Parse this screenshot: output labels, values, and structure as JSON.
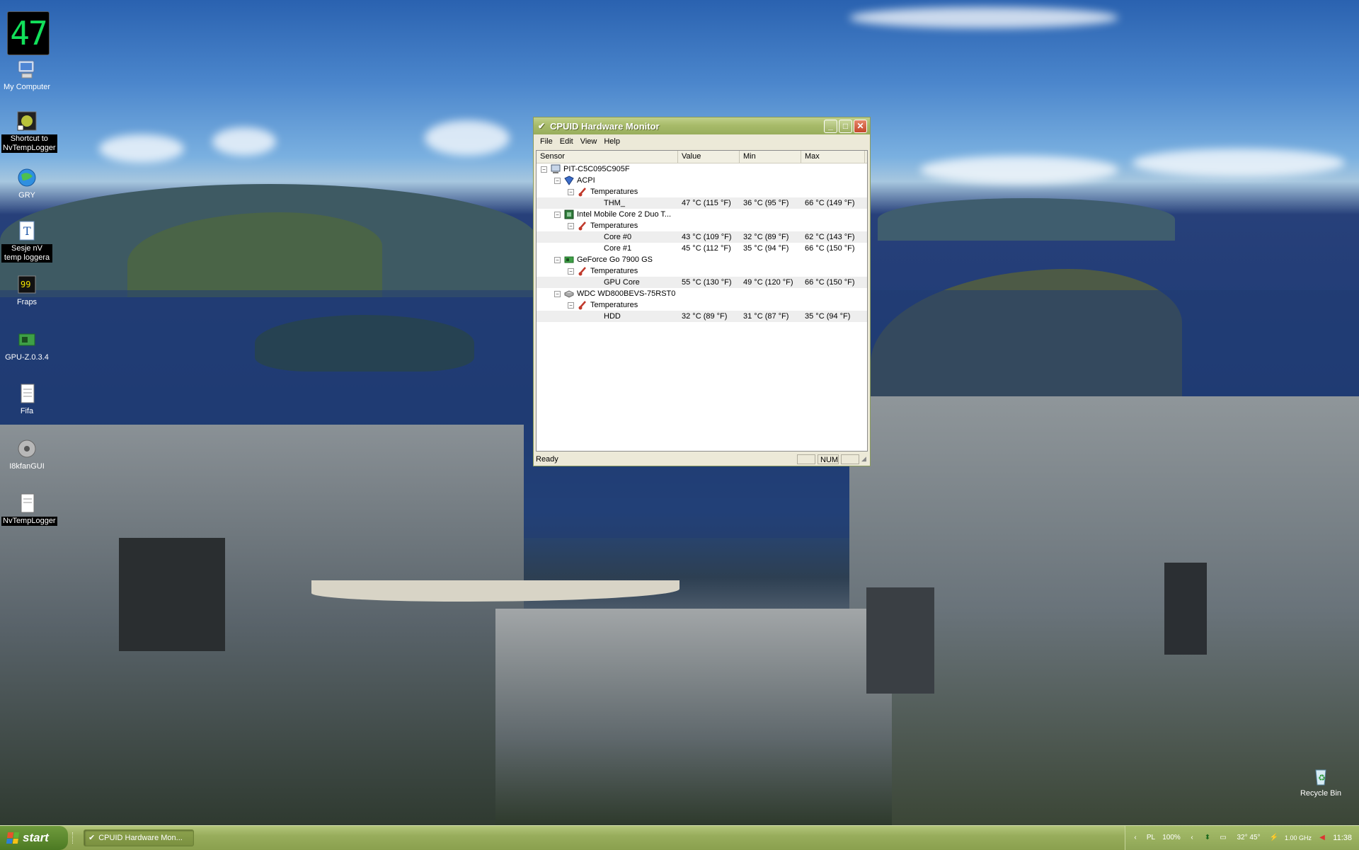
{
  "desktop": {
    "temperature_widget": "47",
    "icons": [
      {
        "label": "My Computer",
        "icon": "computer-icon"
      },
      {
        "label": "Shortcut to NvTempLogger",
        "icon": "nvidia-shortcut-icon"
      },
      {
        "label": "GRY",
        "icon": "globe-icon"
      },
      {
        "label": "Sesje nV temp loggera",
        "icon": "text-document-icon"
      },
      {
        "label": "Fraps",
        "icon": "fraps-icon"
      },
      {
        "label": "GPU-Z.0.3.4",
        "icon": "gpu-icon"
      },
      {
        "label": "Fifa",
        "icon": "document-icon"
      },
      {
        "label": "I8kfanGUI",
        "icon": "fan-icon"
      },
      {
        "label": "NvTempLogger",
        "icon": "document-icon"
      }
    ],
    "recycle_bin": "Recycle Bin"
  },
  "window": {
    "title": "CPUID Hardware Monitor",
    "menu": [
      "File",
      "Edit",
      "View",
      "Help"
    ],
    "columns": [
      "Sensor",
      "Value",
      "Min",
      "Max"
    ],
    "tree": [
      {
        "label": "PIT-C5C095C905F",
        "icon": "computer-icon"
      },
      {
        "label": "ACPI",
        "icon": "acpi-icon"
      },
      {
        "label": "Temperatures",
        "icon": "thermometer-icon"
      },
      {
        "label": "THM_",
        "value": "47 °C (115 °F)",
        "min": "36 °C (95 °F)",
        "max": "66 °C (149 °F)"
      },
      {
        "label": "Intel Mobile Core 2 Duo T...",
        "icon": "cpu-icon"
      },
      {
        "label": "Temperatures",
        "icon": "thermometer-icon"
      },
      {
        "label": "Core #0",
        "value": "43 °C (109 °F)",
        "min": "32 °C (89 °F)",
        "max": "62 °C (143 °F)"
      },
      {
        "label": "Core #1",
        "value": "45 °C (112 °F)",
        "min": "35 °C (94 °F)",
        "max": "66 °C (150 °F)"
      },
      {
        "label": "GeForce Go 7900 GS",
        "icon": "gpu-icon"
      },
      {
        "label": "Temperatures",
        "icon": "thermometer-icon"
      },
      {
        "label": "GPU Core",
        "value": "55 °C (130 °F)",
        "min": "49 °C (120 °F)",
        "max": "66 °C (150 °F)"
      },
      {
        "label": "WDC WD800BEVS-75RST0",
        "icon": "hdd-icon"
      },
      {
        "label": "Temperatures",
        "icon": "thermometer-icon"
      },
      {
        "label": "HDD",
        "value": "32 °C (89 °F)",
        "min": "31 °C (87 °F)",
        "max": "35 °C (94 °F)"
      }
    ],
    "status": "Ready",
    "status_num": "NUM"
  },
  "taskbar": {
    "start": "start",
    "task": "CPUID Hardware Mon...",
    "tray_lang": "PL",
    "tray_battery": "100%",
    "tray_cpu_temp": "32° 45°",
    "tray_freq": "1.00 GHz",
    "clock": "11:38"
  },
  "colors": {
    "title_bar": "#a8bb6a",
    "taskbar": "#98ad5c",
    "start_button": "#4c7a23",
    "widget_digits": "#12e05a"
  }
}
